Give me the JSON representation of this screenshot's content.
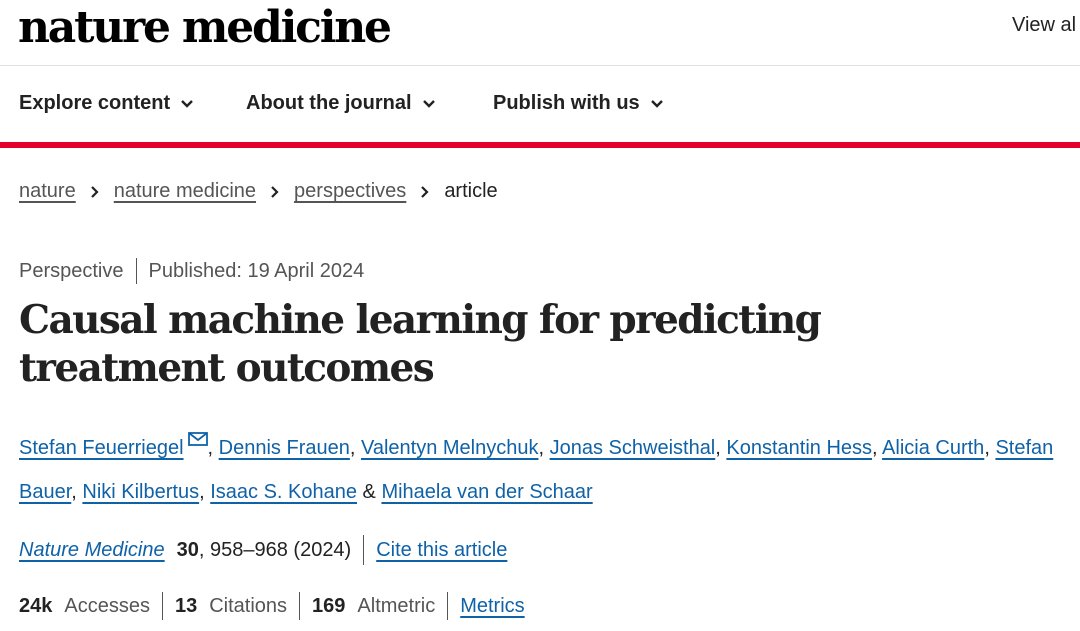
{
  "header": {
    "logo": "nature medicine",
    "view_all": "View al"
  },
  "nav": {
    "items": [
      {
        "label": "Explore content"
      },
      {
        "label": "About the journal"
      },
      {
        "label": "Publish with us"
      }
    ]
  },
  "colors": {
    "accent_bar": "#e4002b",
    "link": "#0f62a8"
  },
  "breadcrumb": {
    "items": [
      "nature",
      "nature medicine",
      "perspectives"
    ],
    "current": "article"
  },
  "article": {
    "type": "Perspective",
    "published": "Published: 19 April 2024",
    "title": "Causal machine learning for predicting treatment outcomes",
    "authors": [
      "Stefan Feuerriegel",
      "Dennis Frauen",
      "Valentyn Melnychuk",
      "Jonas Schweisthal",
      "Konstantin Hess",
      "Alicia Curth",
      "Stefan Bauer",
      "Niki Kilbertus",
      "Isaac S. Kohane",
      "Mihaela van der Schaar"
    ],
    "author_separator": ", ",
    "author_last_separator": " & ",
    "corresponding_icon": "mail-icon"
  },
  "citation": {
    "journal": "Nature Medicine",
    "volume": "30",
    "pages_year": ", 958–968 (2024)",
    "cite_label": "Cite this article"
  },
  "metrics": {
    "accesses_value": "24k",
    "accesses_label": "Accesses",
    "citations_value": "13",
    "citations_label": "Citations",
    "altmetric_value": "169",
    "altmetric_label": "Altmetric",
    "metrics_link": "Metrics"
  }
}
